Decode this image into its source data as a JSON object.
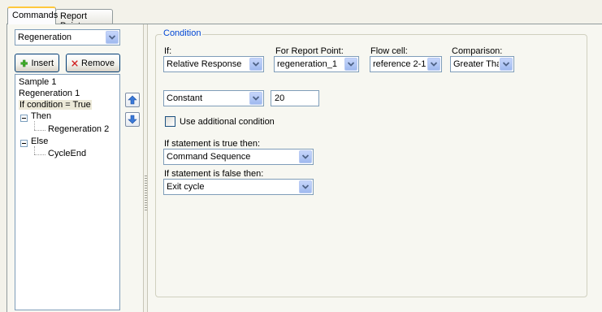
{
  "tabs": [
    {
      "label": "Commands",
      "active": true
    },
    {
      "label": "Report Points",
      "active": false
    }
  ],
  "left_panel": {
    "command_select": "Regeneration",
    "insert_label": "Insert",
    "remove_label": "Remove",
    "list": {
      "sample": "Sample 1",
      "regeneration": "Regeneration 1",
      "condition": "If condition = True",
      "then": "Then",
      "then_child": "Regeneration 2",
      "else": "Else",
      "else_child": "CycleEnd"
    }
  },
  "condition": {
    "group_title": "Condition",
    "if_label": "If:",
    "if_value": "Relative Response",
    "report_point_label": "For Report Point:",
    "report_point_value": "regeneration_1",
    "flow_cell_label": "Flow cell:",
    "flow_cell_value": "reference 2-1",
    "comparison_label": "Comparison:",
    "comparison_value": "Greater Than",
    "operand_type": "Constant",
    "operand_value": "20",
    "additional_label": "Use additional condition",
    "additional_checked": false,
    "true_label": "If statement is true then:",
    "true_value": "Command Sequence",
    "false_label": "If statement is false then:",
    "false_value": "Exit cycle"
  },
  "colors": {
    "group_title": "#0046d5",
    "active_tab_accent": "#ffc83c",
    "selected_item_bg": "#ece9d8"
  }
}
